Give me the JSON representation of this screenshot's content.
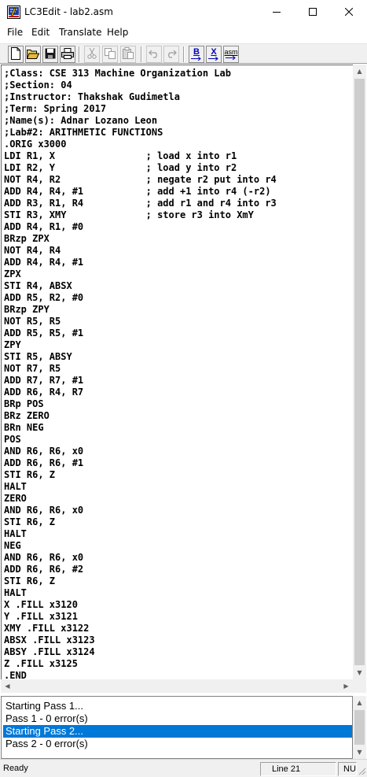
{
  "window": {
    "title": "LC3Edit - lab2.asm",
    "icon": "lc3edit-app-icon"
  },
  "menu": [
    "File",
    "Edit",
    "Translate",
    "Help"
  ],
  "toolbar": {
    "buttons": [
      "new-file-icon",
      "open-folder-icon",
      "save-icon",
      "print-icon",
      "cut-icon",
      "copy-icon",
      "paste-icon",
      "undo-icon",
      "redo-icon",
      "to-binary-icon",
      "to-hex-icon",
      "assemble-icon"
    ],
    "labels": {
      "binary": "B",
      "hex": "X",
      "asm": "asm"
    }
  },
  "editor": {
    "lines": [
      ";Class: CSE 313 Machine Organization Lab",
      ";Section: 04",
      ";Instructor: Thakshak Gudimetla",
      ";Term: Spring 2017",
      ";Name(s): Adnar Lozano Leon",
      ";Lab#2: ARITHMETIC FUNCTIONS",
      ".ORIG x3000",
      "LDI R1, X                ; load x into r1",
      "LDI R2, Y                ; load y into r2",
      "NOT R4, R2               ; negate r2 put into r4",
      "ADD R4, R4, #1           ; add +1 into r4 (-r2)",
      "ADD R3, R1, R4           ; add r1 and r4 into r3",
      "STI R3, XMY              ; store r3 into XmY",
      "ADD R4, R1, #0",
      "BRzp ZPX",
      "NOT R4, R4",
      "ADD R4, R4, #1",
      "ZPX",
      "STI R4, ABSX",
      "ADD R5, R2, #0",
      "BRzp ZPY",
      "NOT R5, R5",
      "ADD R5, R5, #1",
      "ZPY",
      "STI R5, ABSY",
      "NOT R7, R5",
      "ADD R7, R7, #1",
      "ADD R6, R4, R7",
      "BRp POS",
      "BRz ZERO",
      "BRn NEG",
      "POS",
      "AND R6, R6, x0",
      "ADD R6, R6, #1",
      "STI R6, Z",
      "HALT",
      "ZERO",
      "AND R6, R6, x0",
      "STI R6, Z",
      "HALT",
      "NEG",
      "AND R6, R6, x0",
      "ADD R6, R6, #2",
      "STI R6, Z",
      "HALT",
      "X .FILL x3120",
      "Y .FILL x3121",
      "XMY .FILL x3122",
      "ABSX .FILL x3123",
      "ABSY .FILL x3124",
      "Z .FILL x3125",
      ".END"
    ]
  },
  "output": {
    "lines": [
      "Starting Pass 1...",
      "Pass 1 - 0 error(s)",
      "Starting Pass 2...",
      "Pass 2 - 0 error(s)"
    ],
    "selected_index": 2,
    "selection_color": "#0078d7"
  },
  "status": {
    "state": "Ready",
    "position": "Line 21",
    "mode": "NUM"
  }
}
